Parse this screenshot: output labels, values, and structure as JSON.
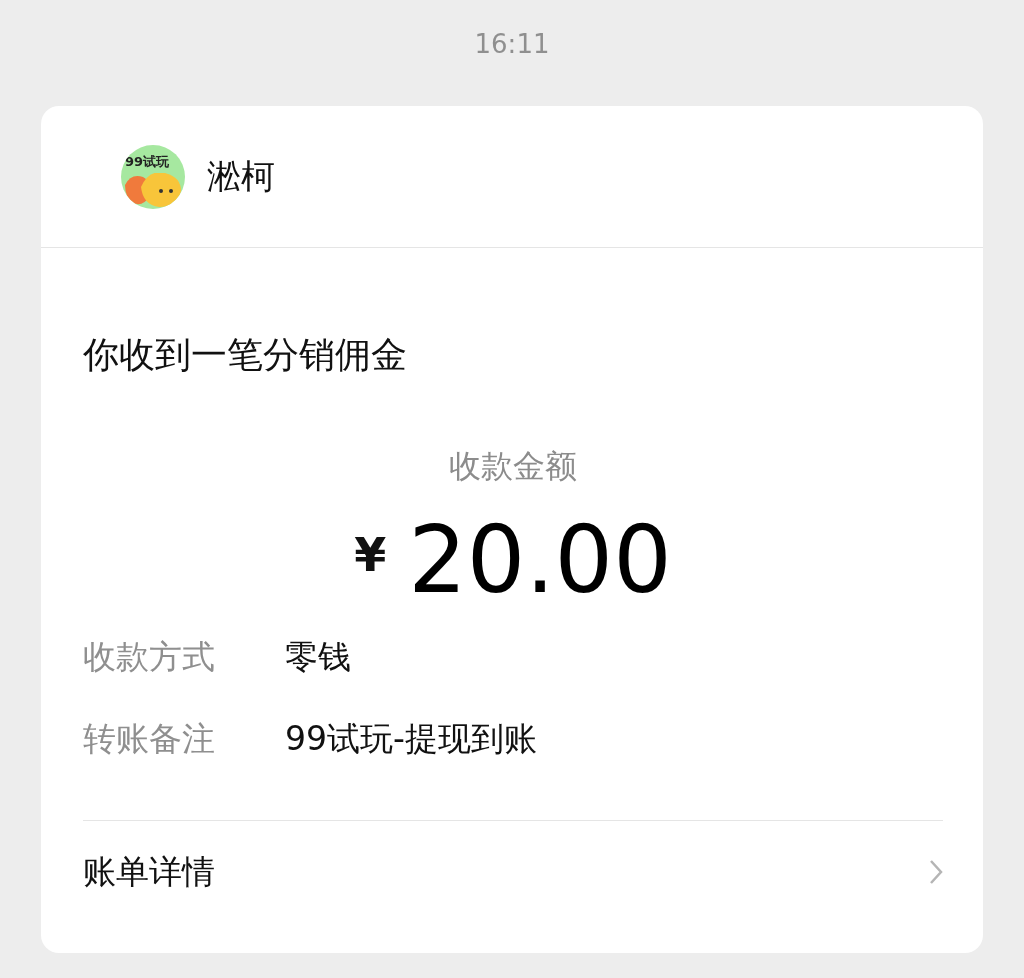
{
  "time": "16:11",
  "sender": {
    "avatar_text": "99试玩",
    "name": "淞柯"
  },
  "title": "你收到一笔分销佣金",
  "amount": {
    "label": "收款金额",
    "currency": "¥",
    "value": "20.00"
  },
  "details": [
    {
      "label": "收款方式",
      "value": "零钱"
    },
    {
      "label": "转账备注",
      "value": "99试玩-提现到账"
    }
  ],
  "footer": {
    "label": "账单详情"
  }
}
